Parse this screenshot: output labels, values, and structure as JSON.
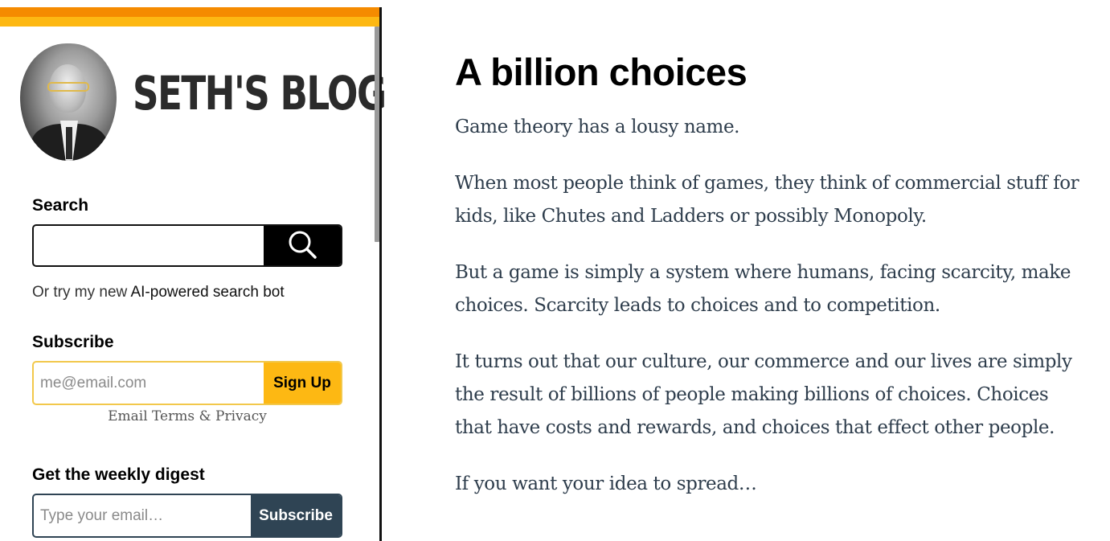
{
  "sidebar": {
    "blog_title": "SETH'S BLOG",
    "search": {
      "label": "Search",
      "value": "",
      "button_icon": "search-icon"
    },
    "ai_prompt": {
      "prefix": "Or try my new",
      "link_text": "AI-powered search bot"
    },
    "subscribe": {
      "label": "Subscribe",
      "placeholder": "me@email.com",
      "button_label": "Sign Up",
      "terms_link": "Email Terms & Privacy"
    },
    "digest": {
      "label": "Get the weekly digest",
      "placeholder": "Type your email…",
      "button_label": "Subscribe"
    }
  },
  "post": {
    "title": "A billion choices",
    "paragraphs": [
      "Game theory has a lousy name.",
      "When most people think of games, they think of commercial stuff for kids, like Chutes and Ladders or possibly Monopoly.",
      "But a game is simply a system where humans, facing scarcity, make choices. Scarcity leads to choices and to competition.",
      "It turns out that our culture, our commerce and our lives are simply the result of billions of people making billions of choices. Choices that have costs and rewards, and choices that effect other people.",
      "If you want your idea to spread…"
    ]
  },
  "colors": {
    "accent_orange": "#f58b00",
    "accent_yellow": "#fdb813",
    "digest_navy": "#2f4454",
    "body_text": "#2e3d4c"
  }
}
